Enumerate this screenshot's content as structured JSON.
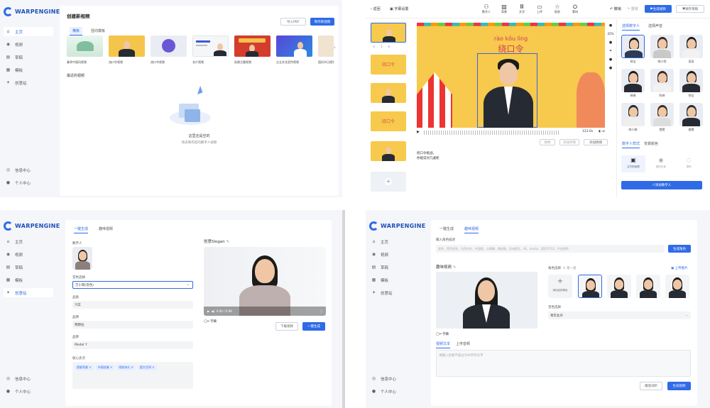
{
  "brand": "WARPENGINE",
  "nav": [
    {
      "label": "主页"
    },
    {
      "label": "视频"
    },
    {
      "label": "草稿"
    },
    {
      "label": "模板"
    },
    {
      "label": "创意站"
    }
  ],
  "bottom_nav": [
    {
      "label": "信息中心"
    },
    {
      "label": "个人中心"
    }
  ],
  "p1": {
    "title": "创建新视频",
    "import_ppt": "导入PDF",
    "create_new": "制作新视频",
    "tabs": [
      "横板",
      "竖向模板"
    ],
    "templates": [
      "春季中国风视频",
      "流口令视频",
      "流口令视频",
      "名片视频",
      "创建主题视频",
      "企业文化宣传视频",
      "国风节日视频"
    ],
    "recent": "最近的视频",
    "empty1": "这里还是空的",
    "empty2": "快去制作您的数字人视频"
  },
  "p2": {
    "back": "返回",
    "subtitle_settings": "字幕设置",
    "tools": [
      "数字人",
      "背景",
      "文字",
      "上传",
      "贴纸",
      "素材"
    ],
    "undo": "撤销",
    "redo": "重做",
    "generate": "生成视频",
    "save_draft": "保存草稿",
    "pinyin": "rào kǒu lìng",
    "banner": "绕口令",
    "time": "123.0s",
    "speed": "倍速",
    "zoom": "42%",
    "actions": [
      "替换",
      "添加停顿",
      "添加情绪"
    ],
    "script1": "绕口令挑战，",
    "script2": "你能说对几遍呢",
    "thumb_word": "绕口令",
    "right_tabs": [
      "选择数字人",
      "选择声音"
    ],
    "avatars": [
      "晓宝",
      "晓小悦",
      "斐斐",
      "晓梅",
      "陈婷",
      "悦佳",
      "晓小娟",
      "雯雯",
      "美慧"
    ],
    "style_tabs": [
      "数字人样式",
      "背景颜色"
    ],
    "style_opts": [
      "正方形轮廓",
      "圆形形象",
      "透明"
    ],
    "add_avatar": "添加数字人"
  },
  "p3": {
    "tabs": [
      "一键生成",
      "趣味视频"
    ],
    "avatar_label": "数字人",
    "voice_label": "音色选择",
    "voice_value": "万小萌(音色)",
    "category_label": "品类",
    "category_value": "汽车",
    "brand_label": "品牌",
    "brand_value": "特斯拉",
    "product_label": "品牌",
    "product_value": "Model Y",
    "sell_label": "核心卖点",
    "tags": [
      "智能驾驶",
      "外观炫美",
      "续航持久",
      "超大空间"
    ],
    "slogan_title": "创意Slogan",
    "subtitle": "字幕",
    "download": "下载视频",
    "generate": "一键生成",
    "video_time": "0:00 / 0:08"
  },
  "p4": {
    "tabs": [
      "一键生成",
      "趣味视频"
    ],
    "desc_label": "输入角色描述",
    "desc_placeholder": "女性，黑色短发，白色衬衫，外国脸，大眼睛，黄皮肤，亚洲面孔，4k，studio，索尼A7S3，专业照明",
    "gen_role": "生成角色",
    "preview_title": "趣味视频",
    "role_label": "角色选择",
    "role_count": "第一组",
    "upload_img": "上传图片",
    "add_role": "添加自然角色",
    "voice_label": "音色选择",
    "voice_value": "青年女声",
    "subtitle": "字幕",
    "text_tabs": [
      "视频文本",
      "上传音频"
    ],
    "text_placeholder": "请输入您要不超过500字的文字",
    "preview": "播放试听",
    "generate": "生成视频"
  }
}
